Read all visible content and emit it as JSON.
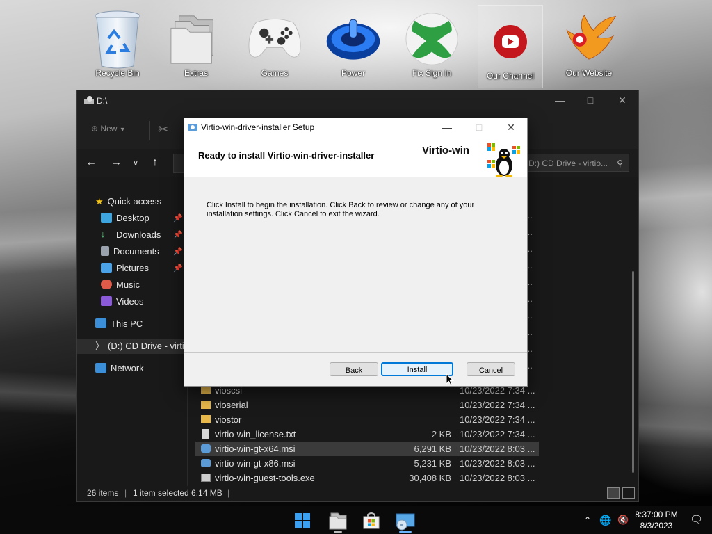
{
  "desktop": {
    "icons": [
      {
        "label": "Recycle Bin",
        "icon": "recycle-bin-icon"
      },
      {
        "label": "Extras",
        "icon": "folder-stack-icon"
      },
      {
        "label": "Games",
        "icon": "gamepad-icon"
      },
      {
        "label": "Power",
        "icon": "power-icon"
      },
      {
        "label": "Fix Sign In",
        "icon": "xbox-icon"
      },
      {
        "label": "Our Channel",
        "icon": "youtube-icon"
      },
      {
        "label": "Our Website",
        "icon": "phoenix-logo-icon"
      }
    ]
  },
  "explorer": {
    "title": "D:\\",
    "toolbar": {
      "new_label": "New"
    },
    "search_placeholder": "D:) CD Drive - virtio...",
    "nav": [
      {
        "label": "Quick access"
      },
      {
        "label": "Desktop"
      },
      {
        "label": "Downloads"
      },
      {
        "label": "Documents"
      },
      {
        "label": "Pictures"
      },
      {
        "label": "Music"
      },
      {
        "label": "Videos"
      },
      {
        "label": "This PC"
      },
      {
        "label": "(D:) CD Drive - virti"
      },
      {
        "label": "Network"
      }
    ],
    "files": [
      {
        "name": "vioscsi",
        "size": "",
        "date": "10/23/2022 7:34 ...",
        "type": "folder"
      },
      {
        "name": "vioserial",
        "size": "",
        "date": "10/23/2022 7:34 ...",
        "type": "folder"
      },
      {
        "name": "viostor",
        "size": "",
        "date": "10/23/2022 7:34 ...",
        "type": "folder"
      },
      {
        "name": "virtio-win_license.txt",
        "size": "2 KB",
        "date": "10/23/2022 7:34 ...",
        "type": "txt"
      },
      {
        "name": "virtio-win-gt-x64.msi",
        "size": "6,291 KB",
        "date": "10/23/2022 8:03 ...",
        "type": "msi"
      },
      {
        "name": "virtio-win-gt-x86.msi",
        "size": "5,231 KB",
        "date": "10/23/2022 8:03 ...",
        "type": "msi"
      },
      {
        "name": "virtio-win-guest-tools.exe",
        "size": "30,408 KB",
        "date": "10/23/2022 8:03 ...",
        "type": "exe"
      }
    ],
    "status": {
      "items": "26 items",
      "selected": "1 item selected  6.14 MB"
    }
  },
  "dialog": {
    "title": "Virtio-win-driver-installer Setup",
    "heading": "Ready to install Virtio-win-driver-installer",
    "brand": "Virtio-win",
    "description": "Click Install to begin the installation. Click Back to review or change any of your installation settings. Click Cancel to exit the wizard.",
    "buttons": {
      "back": "Back",
      "install": "Install",
      "cancel": "Cancel"
    }
  },
  "taskbar": {
    "time": "8:37:00 PM",
    "date": "8/3/2023"
  },
  "colors": {
    "accent": "#0078d7",
    "folder": "#e8b84a"
  }
}
